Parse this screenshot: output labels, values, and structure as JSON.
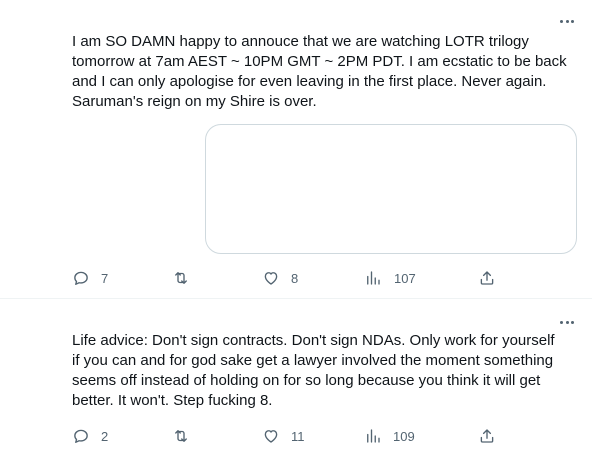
{
  "tweets": [
    {
      "text": "I am SO DAMN happy to annouce that we are watching LOTR trilogy\ntomorrow at 7am AEST ~ 10PM GMT ~ 2PM PDT. I am ecstatic to be back\nand I can only apologise for even leaving in the first place. Never again.\nSaruman's reign on my Shire is over.",
      "replies": "7",
      "retweets": "",
      "likes": "8",
      "views": "107",
      "has_media_card": true
    },
    {
      "text": "Life advice: Don't sign contracts. Don't sign NDAs. Only work for yourself\nif you can and for god sake get a lawyer involved the moment something\nseems off instead of holding on for so long because you think it will get\nbetter. It won't. Step fucking 8.",
      "replies": "2",
      "retweets": "",
      "likes": "11",
      "views": "109",
      "has_media_card": false
    }
  ],
  "icons": {
    "more": "more-horizontal-icon",
    "reply": "reply-icon",
    "retweet": "retweet-icon",
    "like": "heart-icon",
    "views": "views-bar-chart-icon",
    "share": "share-icon"
  },
  "colors": {
    "text": "#0f1419",
    "muted": "#536471",
    "border": "#cfd9de",
    "divider": "#eff3f4"
  }
}
